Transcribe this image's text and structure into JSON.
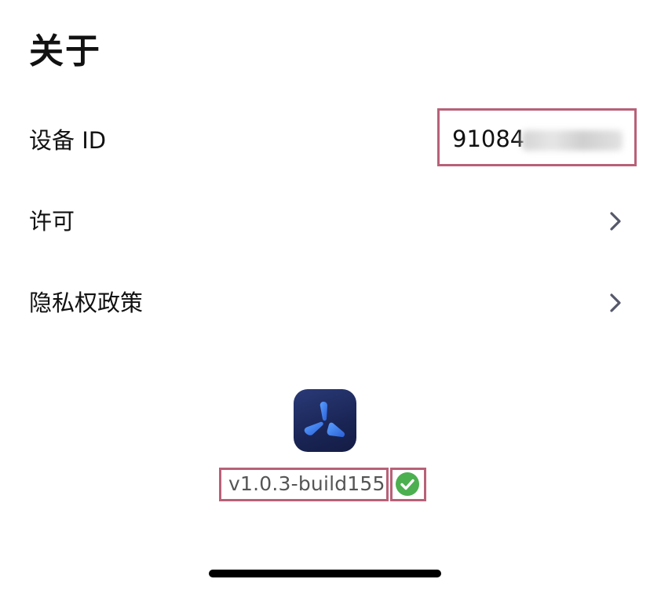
{
  "header": {
    "title": "关于"
  },
  "rows": {
    "device_id": {
      "label": "设备 ID",
      "value_visible": "91084"
    },
    "license": {
      "label": "许可"
    },
    "privacy": {
      "label": "隐私权政策"
    }
  },
  "footer": {
    "version": "v1.0.3-build155",
    "verified_icon": "check-circle-icon",
    "app_icon": "app-logo-icon"
  },
  "icons": {
    "chevron": "chevron-right-icon"
  },
  "colors": {
    "highlight_border": "#b86178",
    "verified_green": "#4caf50",
    "chevron": "#55586a",
    "app_icon_bg": "#1a2555",
    "app_icon_accent": "#3a7be8"
  }
}
